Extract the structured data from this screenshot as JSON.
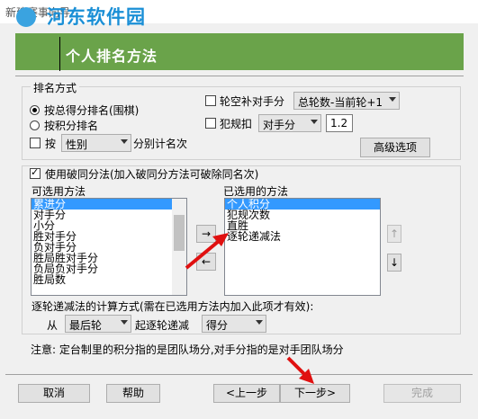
{
  "window": {
    "title": "新建赛事向导",
    "watermark": "河东软件园"
  },
  "banner": {
    "title": "个人排名方法"
  },
  "ranking": {
    "group_label": "排名方式",
    "radio_total": "按总得分排名(围棋)",
    "radio_points": "按积分排名",
    "chk_by": "按",
    "by_field": "性别",
    "by_suffix": "分别计名次",
    "chk_bye": "轮空补对手分",
    "bye_value": "总轮数-当前轮+1",
    "chk_foul": "犯规扣",
    "foul_field": "对手分",
    "foul_value": "1.2",
    "advanced": "高级选项"
  },
  "tiebreak": {
    "chk_label": "使用破同分法(加入破同分方法可破除同名次)",
    "available_label": "可选用方法",
    "selected_label": "已选用的方法",
    "available": [
      "累进分",
      "对手分",
      "小分",
      "胜对手分",
      "负对手分",
      "胜局胜对手分",
      "负局负对手分",
      "胜局数"
    ],
    "available_selected_index": 0,
    "selected": [
      "个人积分",
      "犯规次数",
      "直胜",
      "逐轮递减法"
    ],
    "selected_selected_index": 0,
    "add": "→",
    "remove": "←",
    "up": "↑",
    "down": "↓",
    "calc_label": "逐轮递减法的计算方式(需在已选用方法内加入此项才有效):",
    "from": "从",
    "from_value": "最后轮",
    "mid": "起逐轮递减",
    "by_value": "得分"
  },
  "note": "注意: 定台制里的积分指的是团队场分,对手分指的是对手团队场分",
  "footer": {
    "cancel": "取消",
    "help": "帮助",
    "prev": "<上一步",
    "next": "下一步>",
    "finish": "完成"
  },
  "colors": {
    "banner": "#6aa34a",
    "selection": "#3399ff",
    "annotation_arrow": "#e01010"
  }
}
